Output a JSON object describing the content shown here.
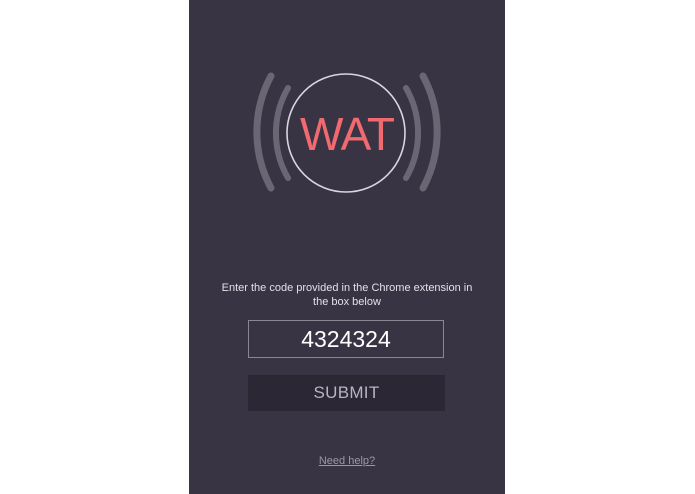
{
  "logo": {
    "text": "WAT",
    "icon": "broadcast-signal-icon",
    "text_color": "#f06a6f",
    "ring_color": "#d8d6df",
    "wave_color": "#6a6673"
  },
  "instructions": {
    "text": "Enter the code provided in the Chrome extension in the box below"
  },
  "code_input": {
    "value": "4324324"
  },
  "submit": {
    "label": "SUBMIT"
  },
  "help": {
    "label": "Need help?"
  },
  "colors": {
    "panel_background": "#393444",
    "button_background": "#2b2735"
  }
}
